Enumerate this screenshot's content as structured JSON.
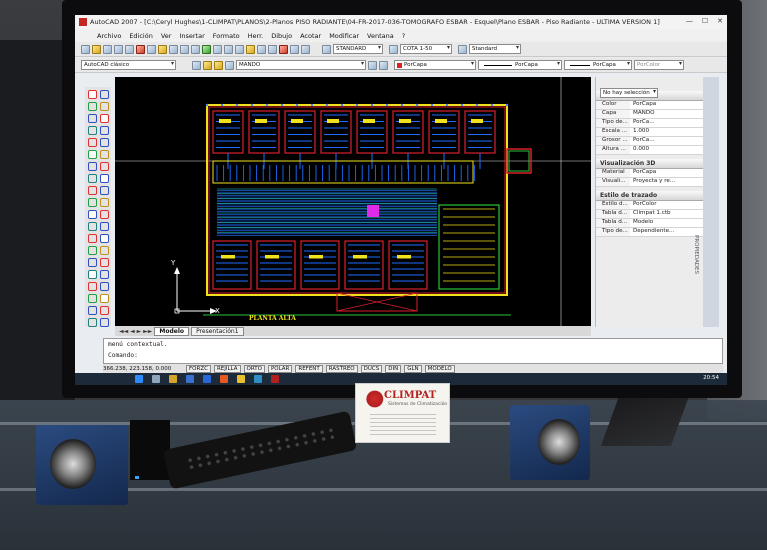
{
  "app": {
    "title": "AutoCAD 2007 - [C:\\Ceryl Hughes\\1-CLIMPAT\\PLANOS\\2-Planos PISO RADIANTE\\04-FR-2017-036-TOMOGRAFO ESBAR - Esquel\\Plano ESBAR - Piso Radiante - ULTIMA VERSION 1]",
    "window_controls": [
      "—",
      "☐",
      "✕"
    ]
  },
  "menu": [
    "Archivo",
    "Edición",
    "Ver",
    "Insertar",
    "Formato",
    "Herr.",
    "Dibujo",
    "Acotar",
    "Modificar",
    "Ventana",
    "?"
  ],
  "toolbar1": {
    "text_style": "STANDARD",
    "dim_style": "COTA 1-50",
    "table_style": "Standard"
  },
  "toolbar2": {
    "workspace": "AutoCAD clásico",
    "layer": "MANDO",
    "color": "PorCapa",
    "linetype": "PorCapa",
    "lineweight": "PorCapa",
    "plotstyle": "PorColor"
  },
  "drawing": {
    "plan_label": "PLANTA ALTA",
    "axis_x": "X",
    "axis_y": "Y"
  },
  "layout_tabs": [
    "Modelo",
    "Presentación1"
  ],
  "properties": {
    "selection": "No hay selección",
    "vertical_title": "PROPIEDADES",
    "sections": [
      {
        "title": "General",
        "rows": [
          {
            "k": "Color",
            "v": "PorCapa"
          },
          {
            "k": "Capa",
            "v": "MANDO"
          },
          {
            "k": "Tipo de...",
            "v": "PorCa..."
          },
          {
            "k": "Escala ...",
            "v": "1.000"
          },
          {
            "k": "Grosor ...",
            "v": "PorCa..."
          },
          {
            "k": "Altura ...",
            "v": "0.000"
          }
        ]
      },
      {
        "title": "Visualización 3D",
        "rows": [
          {
            "k": "Material",
            "v": "PorCapa"
          },
          {
            "k": "Visuali...",
            "v": "Proyecta y re..."
          }
        ]
      },
      {
        "title": "Estilo de trazado",
        "rows": [
          {
            "k": "Estilo d...",
            "v": "PorColor"
          },
          {
            "k": "Tabla d...",
            "v": "Climpat 1.ctb"
          },
          {
            "k": "Tabla d...",
            "v": "Modelo"
          },
          {
            "k": "Tipo de...",
            "v": "Dependiente..."
          }
        ]
      }
    ]
  },
  "command": {
    "line1": "menú contextual.",
    "line2": "Comando:"
  },
  "status": {
    "coords": "366.238, 223.158, 0.000",
    "toggles": [
      "FORZC",
      "REJILLA",
      "ORTO",
      "POLAR",
      "REFENT",
      "RASTREO",
      "DUCS",
      "DIN",
      "GLN",
      "MODELO"
    ]
  },
  "taskbar": {
    "clock": "20:54"
  },
  "business_card": {
    "brand": "CLIMPAT",
    "tagline": "Sistemas de Climatización"
  },
  "colors": {
    "canvas": "#000000",
    "wall_red": "#d8202c",
    "pipe_blue": "#1e6cff",
    "room_yellow": "#f2e21e",
    "cyan": "#28d8e8",
    "green": "#29c43a",
    "magenta": "#e02ae8"
  }
}
